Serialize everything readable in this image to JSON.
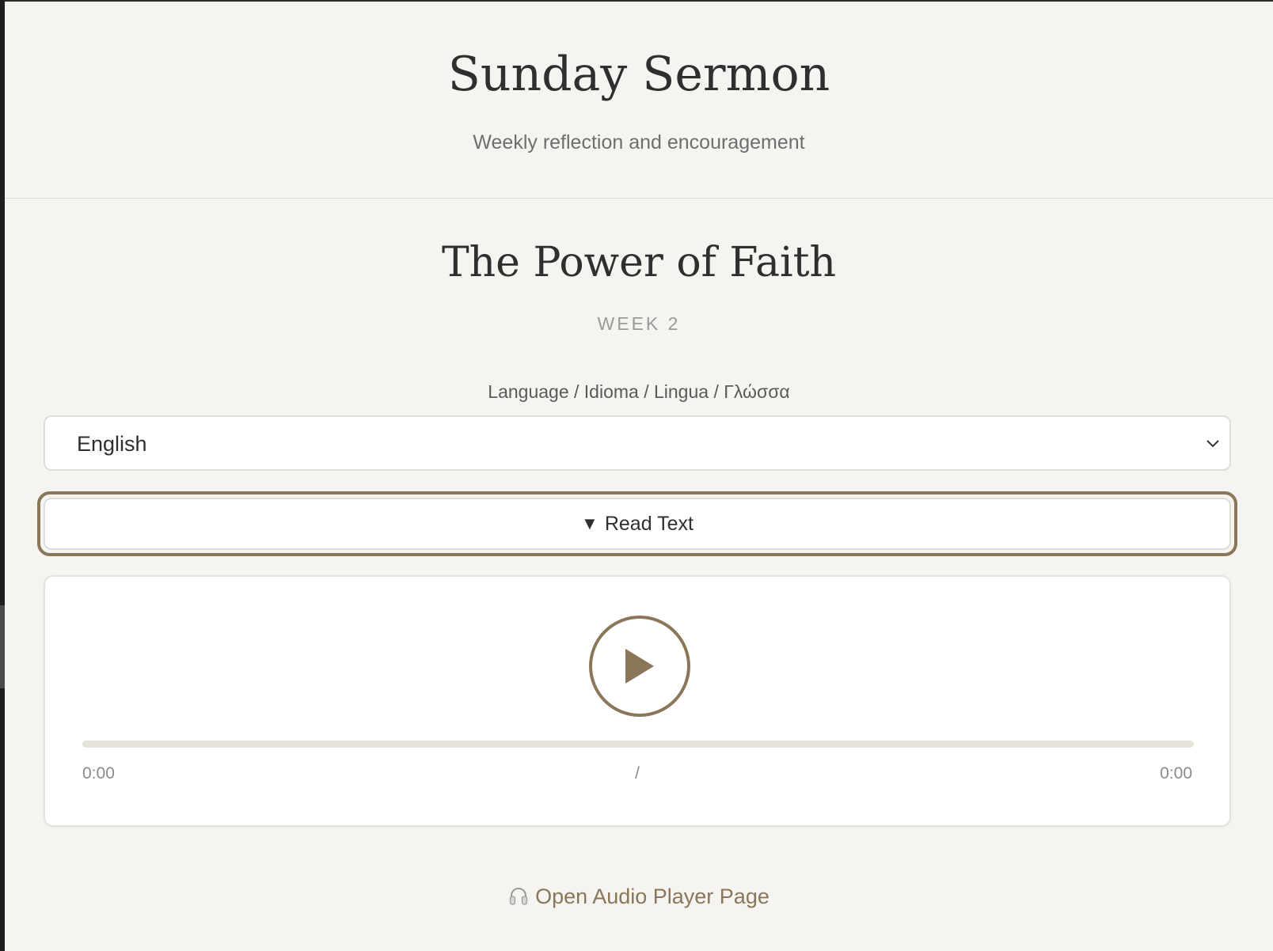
{
  "header": {
    "title": "Sunday Sermon",
    "subtitle": "Weekly reflection and encouragement"
  },
  "sermon": {
    "title": "The Power of Faith",
    "week": "WEEK 2"
  },
  "language": {
    "label": "Language / Idioma / Lingua / Γλώσσα",
    "selected": "English"
  },
  "read_text": {
    "label": "Read Text",
    "expand_glyph": "▼"
  },
  "player": {
    "current_time": "0:00",
    "separator": "/",
    "total_time": "0:00",
    "progress_fraction": 0
  },
  "link": {
    "label": "Open Audio Player Page",
    "icon": "headphones-icon"
  },
  "colors": {
    "accent": "#8a7658",
    "background": "#f5f4f1",
    "card": "#ffffff",
    "track": "#e6e3dc"
  }
}
